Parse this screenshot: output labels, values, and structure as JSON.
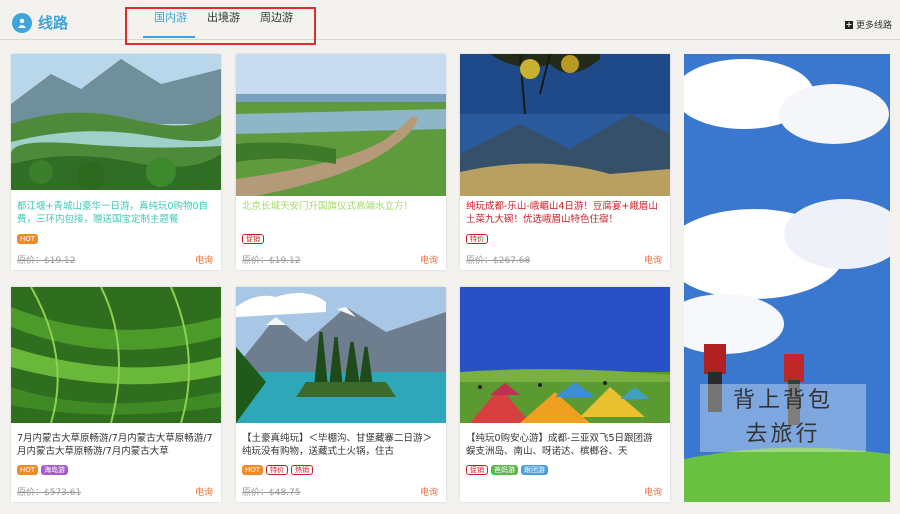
{
  "header": {
    "title": "线路",
    "tabs": [
      "国内游",
      "出境游",
      "周边游"
    ],
    "more": "更多线路"
  },
  "cards": [
    {
      "title": "都江堰+青城山豪华一日游，真纯玩0购物0自费，三环内包接，赠送国宝定制主题餐",
      "tags": [
        "HOT"
      ],
      "price": "原价：$19.12",
      "ask": "电询"
    },
    {
      "title": "北京长城天安门升国旗仪式高端水立方！",
      "tags": [
        "促销"
      ],
      "price": "原价：$19.12",
      "ask": "电询"
    },
    {
      "title": "纯玩成都-乐山-峨嵋山4日游！豆腐宴+峨眉山土菜九大碗！优选峨眉山特色住宿！",
      "tags": [
        "特价"
      ],
      "price": "原价：$267.68",
      "ask": "电询"
    },
    {
      "title": "7月内蒙古大草原畅游/7月内蒙古大草原畅游/7月内蒙古大草原畅游/7月内蒙古大草",
      "tags": [
        "HOT",
        "海岛游"
      ],
      "price": "原价：$573.61",
      "ask": "电询"
    },
    {
      "title": "【土豪真纯玩】＜毕棚沟、甘堡藏寨二日游＞纯玩没有购物，送藏式土火锅，住古",
      "tags": [
        "HOT",
        "特价",
        "热销"
      ],
      "price": "原价：$48.75",
      "ask": "电询"
    },
    {
      "title": "【纯玩0购安心游】成都-三亚双飞5日跟团游 蜈支洲岛、南山、呀诺达、槟榔谷、天",
      "tags": [
        "促销",
        "爸妈游",
        "跟团游"
      ],
      "price": "",
      "ask": "电询"
    }
  ],
  "banner": {
    "line1": "背上背包",
    "line2": "去旅行"
  },
  "colors": {
    "accent": "#3ea4dc",
    "highlight_box": "#e22b2b",
    "ask": "#e8703a"
  }
}
